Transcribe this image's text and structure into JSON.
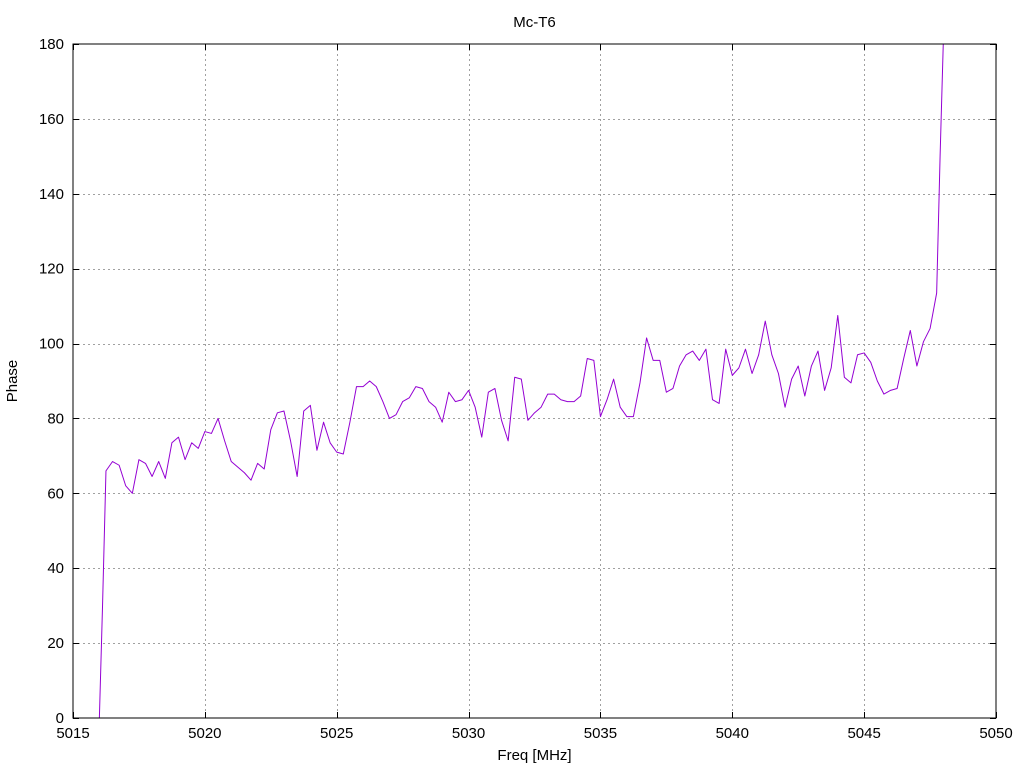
{
  "chart_data": {
    "type": "line",
    "title": "Mc-T6",
    "xlabel": "Freq [MHz]",
    "ylabel": "Phase",
    "xlim": [
      5015,
      5050
    ],
    "ylim": [
      0,
      180
    ],
    "xticks": [
      5015,
      5020,
      5025,
      5030,
      5035,
      5040,
      5045,
      5050
    ],
    "yticks": [
      0,
      20,
      40,
      60,
      80,
      100,
      120,
      140,
      160,
      180
    ],
    "grid": true,
    "legend": "none",
    "line_color": "#9400d3",
    "series": [
      {
        "x": [
          5016,
          5016.12,
          5016.25,
          5016.5,
          5016.75,
          5017,
          5017.25,
          5017.5,
          5017.75,
          5018,
          5018.25,
          5018.5,
          5018.75,
          5019,
          5019.25,
          5019.5,
          5019.75,
          5020,
          5020.25,
          5020.5,
          5020.75,
          5021,
          5021.25,
          5021.5,
          5021.75,
          5022,
          5022.25,
          5022.5,
          5022.75,
          5023,
          5023.25,
          5023.5,
          5023.75,
          5024,
          5024.25,
          5024.5,
          5024.75,
          5025,
          5025.25,
          5025.5,
          5025.75,
          5026,
          5026.25,
          5026.5,
          5026.75,
          5027,
          5027.25,
          5027.5,
          5027.75,
          5028,
          5028.25,
          5028.5,
          5028.75,
          5029,
          5029.25,
          5029.5,
          5029.75,
          5030,
          5030.25,
          5030.5,
          5030.75,
          5031,
          5031.25,
          5031.5,
          5031.75,
          5032,
          5032.25,
          5032.5,
          5032.75,
          5033,
          5033.25,
          5033.5,
          5033.75,
          5034,
          5034.25,
          5034.5,
          5034.75,
          5035,
          5035.25,
          5035.5,
          5035.75,
          5036,
          5036.25,
          5036.5,
          5036.75,
          5037,
          5037.25,
          5037.5,
          5037.75,
          5038,
          5038.25,
          5038.5,
          5038.75,
          5039,
          5039.25,
          5039.5,
          5039.75,
          5040,
          5040.25,
          5040.5,
          5040.75,
          5041,
          5041.25,
          5041.5,
          5041.75,
          5042,
          5042.25,
          5042.5,
          5042.75,
          5043,
          5043.25,
          5043.5,
          5043.75,
          5044,
          5044.25,
          5044.5,
          5044.75,
          5045,
          5045.25,
          5045.5,
          5045.75,
          5046,
          5046.25,
          5046.5,
          5046.75,
          5047,
          5047.25,
          5047.5,
          5047.75,
          5047.88,
          5048
        ],
        "y": [
          0,
          30,
          66,
          68.5,
          67.5,
          62,
          60,
          69,
          68,
          64.5,
          68.5,
          64,
          73.5,
          75,
          69,
          73.5,
          72,
          76.5,
          76,
          80,
          74,
          68.5,
          67,
          65.5,
          63.5,
          68,
          66.5,
          77,
          81.5,
          82,
          74,
          64.5,
          82,
          83.5,
          71.5,
          79,
          73.5,
          71,
          70.5,
          79,
          88.5,
          88.5,
          90,
          88.5,
          84.5,
          80,
          81,
          84.5,
          85.5,
          88.5,
          88,
          84.5,
          83,
          79,
          87,
          84.5,
          85,
          87.5,
          83,
          75,
          87,
          88,
          79.5,
          74,
          91,
          90.5,
          79.5,
          81.5,
          83,
          86.5,
          86.5,
          85,
          84.5,
          84.5,
          86,
          96,
          95.5,
          80.5,
          85,
          90.5,
          83,
          80.5,
          80.5,
          89.5,
          101.5,
          95.5,
          95.5,
          87,
          88,
          94,
          97,
          98,
          95.5,
          98.5,
          85,
          84,
          98.5,
          91.5,
          93.5,
          98.5,
          92,
          97,
          106,
          97,
          92,
          83,
          90.5,
          94,
          86,
          94,
          98,
          87.5,
          93.5,
          107.5,
          91,
          89.5,
          97,
          97.5,
          95,
          90,
          86.5,
          87.5,
          88,
          96,
          103.5,
          94,
          100.5,
          104,
          113.5,
          150,
          180
        ]
      }
    ]
  }
}
